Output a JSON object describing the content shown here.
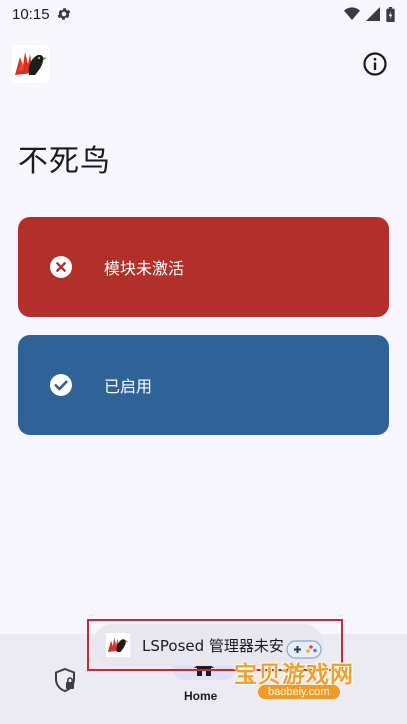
{
  "status_bar": {
    "time": "10:15",
    "icons": [
      "settings-icon",
      "wifi-icon",
      "signal-icon",
      "battery-icon"
    ]
  },
  "header": {
    "logo_icon": "phoenix-logo-icon",
    "info_icon": "info-icon"
  },
  "page": {
    "title": "不死鸟"
  },
  "cards": [
    {
      "label": "模块未激活",
      "icon": "x-circle-icon",
      "color": "#b3302a"
    },
    {
      "label": "已启用",
      "icon": "check-circle-icon",
      "color": "#2f6397"
    }
  ],
  "bottom_nav": {
    "items": [
      {
        "icon": "shield-lock-icon",
        "label": ""
      },
      {
        "icon": "home-icon",
        "label": "Home",
        "selected": true
      }
    ]
  },
  "toast": {
    "text": "LSPosed 管理器未安",
    "icon": "phoenix-logo-icon"
  },
  "watermark": {
    "main": "宝贝游戏网",
    "sub": "baobeiy.com"
  },
  "colors": {
    "background": "#f7f6fd",
    "danger": "#b3302a",
    "primary": "#2f6397",
    "highlight_frame": "#d2262c"
  }
}
